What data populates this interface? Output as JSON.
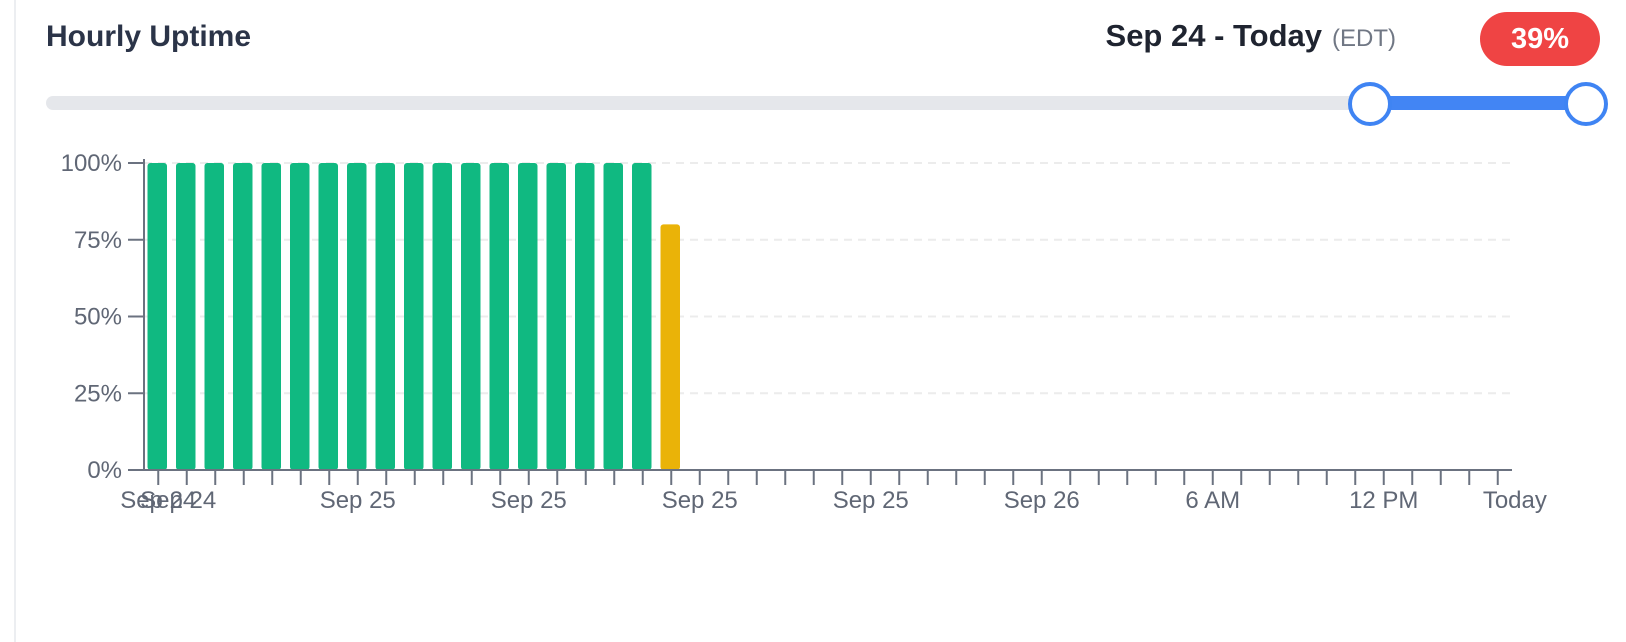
{
  "header": {
    "title": "Hourly Uptime",
    "range_label": "Sep 24 - Today",
    "timezone": "(EDT)",
    "uptime_badge": "39%",
    "badge_color": "#ef4444"
  },
  "range_slider": {
    "start_fraction": 0.86,
    "end_fraction": 1.0,
    "track_color": "#e5e7eb",
    "fill_color": "#4285f4"
  },
  "chart_data": {
    "type": "bar",
    "title": "Hourly Uptime",
    "ylim": [
      0,
      100
    ],
    "y_ticks": [
      "0%",
      "25%",
      "50%",
      "75%",
      "100%"
    ],
    "grid": true,
    "slot_count": 48,
    "values": [
      100,
      100,
      100,
      100,
      100,
      100,
      100,
      100,
      100,
      100,
      100,
      100,
      100,
      100,
      100,
      100,
      100,
      100,
      80
    ],
    "bar_colors": {
      "up": "#10b981",
      "degraded": "#eab308"
    },
    "x_tick_labels": [
      "Sep 24",
      "Sep 24",
      "Sep 25",
      "Sep 25",
      "Sep 25",
      "Sep 25",
      "Sep 26",
      "6 AM",
      "12 PM",
      "Today"
    ]
  }
}
